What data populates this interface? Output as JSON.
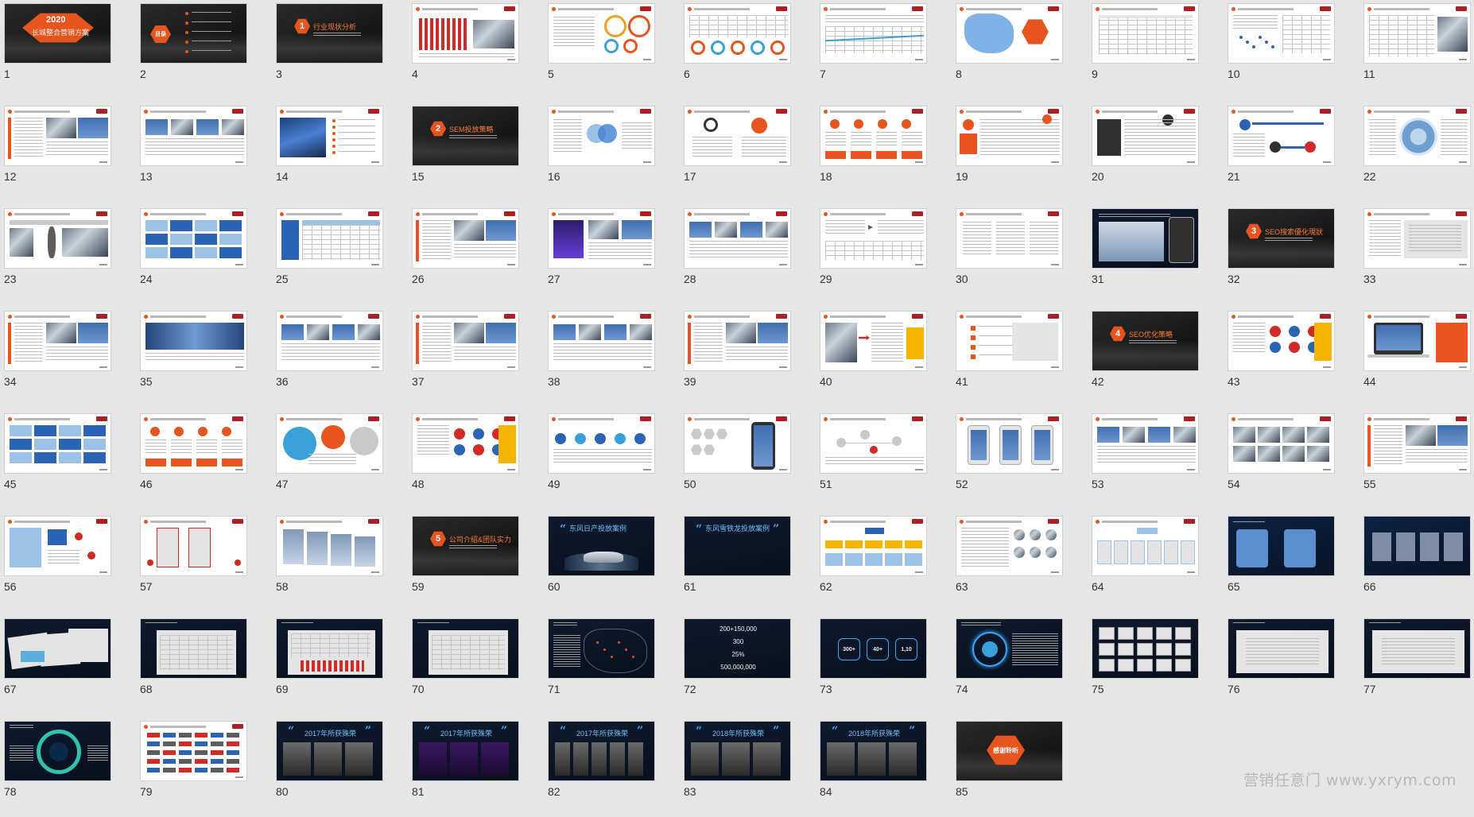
{
  "slides": [
    {
      "n": "1",
      "theme": "dark",
      "kind": "cover",
      "title": "2020",
      "subtitle": "长城整合营销方案"
    },
    {
      "n": "2",
      "theme": "dark",
      "kind": "toc",
      "title": "目录"
    },
    {
      "n": "3",
      "theme": "dark",
      "kind": "section",
      "num": "1",
      "title": "行业现状分析"
    },
    {
      "n": "4",
      "theme": "white",
      "kind": "bars"
    },
    {
      "n": "5",
      "theme": "white",
      "kind": "donuts"
    },
    {
      "n": "6",
      "theme": "white",
      "kind": "rings"
    },
    {
      "n": "7",
      "theme": "white",
      "kind": "linechart"
    },
    {
      "n": "8",
      "theme": "white",
      "kind": "map"
    },
    {
      "n": "9",
      "theme": "white",
      "kind": "table"
    },
    {
      "n": "10",
      "theme": "white",
      "kind": "scatter"
    },
    {
      "n": "11",
      "theme": "white",
      "kind": "table2"
    },
    {
      "n": "12",
      "theme": "white",
      "kind": "screens"
    },
    {
      "n": "13",
      "theme": "white",
      "kind": "screens2"
    },
    {
      "n": "14",
      "theme": "white",
      "kind": "car"
    },
    {
      "n": "15",
      "theme": "dark",
      "kind": "section",
      "num": "2",
      "title": "SEM投放策略"
    },
    {
      "n": "16",
      "theme": "white",
      "kind": "venn"
    },
    {
      "n": "17",
      "theme": "white",
      "kind": "icons"
    },
    {
      "n": "18",
      "theme": "white",
      "kind": "cols-orange"
    },
    {
      "n": "19",
      "theme": "white",
      "kind": "cols-orange2"
    },
    {
      "n": "20",
      "theme": "white",
      "kind": "cols-dark"
    },
    {
      "n": "21",
      "theme": "white",
      "kind": "flow"
    },
    {
      "n": "22",
      "theme": "white",
      "kind": "wheel"
    },
    {
      "n": "23",
      "theme": "white",
      "kind": "people"
    },
    {
      "n": "24",
      "theme": "white",
      "kind": "blue-grid"
    },
    {
      "n": "25",
      "theme": "white",
      "kind": "blue-grid2"
    },
    {
      "n": "26",
      "theme": "white",
      "kind": "screens"
    },
    {
      "n": "27",
      "theme": "white",
      "kind": "purple"
    },
    {
      "n": "28",
      "theme": "white",
      "kind": "screens2"
    },
    {
      "n": "29",
      "theme": "white",
      "kind": "flow2"
    },
    {
      "n": "30",
      "theme": "white",
      "kind": "text-cols"
    },
    {
      "n": "31",
      "theme": "navy",
      "kind": "dashboard"
    },
    {
      "n": "32",
      "theme": "dark",
      "kind": "section",
      "num": "3",
      "title": "SEO搜索優化現狀"
    },
    {
      "n": "33",
      "theme": "white",
      "kind": "screen-single"
    },
    {
      "n": "34",
      "theme": "white",
      "kind": "screens"
    },
    {
      "n": "35",
      "theme": "white",
      "kind": "banner"
    },
    {
      "n": "36",
      "theme": "white",
      "kind": "screens2"
    },
    {
      "n": "37",
      "theme": "white",
      "kind": "screens"
    },
    {
      "n": "38",
      "theme": "white",
      "kind": "screens2"
    },
    {
      "n": "39",
      "theme": "white",
      "kind": "screens"
    },
    {
      "n": "40",
      "theme": "white",
      "kind": "arrows"
    },
    {
      "n": "41",
      "theme": "white",
      "kind": "list-orange"
    },
    {
      "n": "42",
      "theme": "dark",
      "kind": "section",
      "num": "4",
      "title": "SEO优化策略"
    },
    {
      "n": "43",
      "theme": "white",
      "kind": "logos"
    },
    {
      "n": "44",
      "theme": "white",
      "kind": "laptop"
    },
    {
      "n": "45",
      "theme": "white",
      "kind": "blue-grid"
    },
    {
      "n": "46",
      "theme": "white",
      "kind": "cols-orange"
    },
    {
      "n": "47",
      "theme": "white",
      "kind": "bubbles"
    },
    {
      "n": "48",
      "theme": "white",
      "kind": "logos"
    },
    {
      "n": "49",
      "theme": "white",
      "kind": "icons-row"
    },
    {
      "n": "50",
      "theme": "white",
      "kind": "phone"
    },
    {
      "n": "51",
      "theme": "white",
      "kind": "network"
    },
    {
      "n": "52",
      "theme": "white",
      "kind": "phones"
    },
    {
      "n": "53",
      "theme": "white",
      "kind": "screens2"
    },
    {
      "n": "54",
      "theme": "white",
      "kind": "cars-grid"
    },
    {
      "n": "55",
      "theme": "white",
      "kind": "screens"
    },
    {
      "n": "56",
      "theme": "white",
      "kind": "diagram"
    },
    {
      "n": "57",
      "theme": "white",
      "kind": "flow3"
    },
    {
      "n": "58",
      "theme": "white",
      "kind": "panels"
    },
    {
      "n": "59",
      "theme": "dark",
      "kind": "section",
      "num": "5",
      "title": "公司介绍&团队实力"
    },
    {
      "n": "60",
      "theme": "navy",
      "kind": "case",
      "title": "东风日产投放案例"
    },
    {
      "n": "61",
      "theme": "navy",
      "kind": "case-empty",
      "title": "东风雪铁龙投放案例"
    },
    {
      "n": "62",
      "theme": "white",
      "kind": "org"
    },
    {
      "n": "63",
      "theme": "white",
      "kind": "team"
    },
    {
      "n": "64",
      "theme": "white",
      "kind": "org2"
    },
    {
      "n": "65",
      "theme": "blue",
      "kind": "blue-panels"
    },
    {
      "n": "66",
      "theme": "blue",
      "kind": "blue-panels2"
    },
    {
      "n": "67",
      "theme": "navy",
      "kind": "charts-stack"
    },
    {
      "n": "68",
      "theme": "navy",
      "kind": "doc-screen"
    },
    {
      "n": "69",
      "theme": "navy",
      "kind": "doc-screen2"
    },
    {
      "n": "70",
      "theme": "navy",
      "kind": "doc-screen"
    },
    {
      "n": "71",
      "theme": "navy",
      "kind": "china-map"
    },
    {
      "n": "72",
      "theme": "navy",
      "kind": "numbers",
      "lines": [
        "200+150,000",
        "300",
        "25%",
        "500,000,000"
      ]
    },
    {
      "n": "73",
      "theme": "navy",
      "kind": "hexes",
      "vals": [
        "300+",
        "40+",
        "1,10"
      ]
    },
    {
      "n": "74",
      "theme": "navy",
      "kind": "orbit"
    },
    {
      "n": "75",
      "theme": "navy",
      "kind": "certs"
    },
    {
      "n": "76",
      "theme": "navy",
      "kind": "cert-single"
    },
    {
      "n": "77",
      "theme": "navy",
      "kind": "cert-single"
    },
    {
      "n": "78",
      "theme": "navy",
      "kind": "cycle"
    },
    {
      "n": "79",
      "theme": "white",
      "kind": "clients"
    },
    {
      "n": "80",
      "theme": "navy",
      "kind": "awards",
      "title": "2017年所获殊荣"
    },
    {
      "n": "81",
      "theme": "navy",
      "kind": "awards2",
      "title": "2017年所获殊荣"
    },
    {
      "n": "82",
      "theme": "navy",
      "kind": "awards3",
      "title": "2017年所获殊荣"
    },
    {
      "n": "83",
      "theme": "navy",
      "kind": "awards4",
      "title": "2018年所获殊荣"
    },
    {
      "n": "84",
      "theme": "navy",
      "kind": "awards4",
      "title": "2018年所获殊荣"
    },
    {
      "n": "85",
      "theme": "dark",
      "kind": "thanks",
      "title": "感谢聆听"
    }
  ],
  "watermark": "营销任意门 www.yxrym.com",
  "colors": {
    "accent": "#e8541e",
    "bg": "#e6e6e6",
    "blue": "#3ba8ff"
  }
}
